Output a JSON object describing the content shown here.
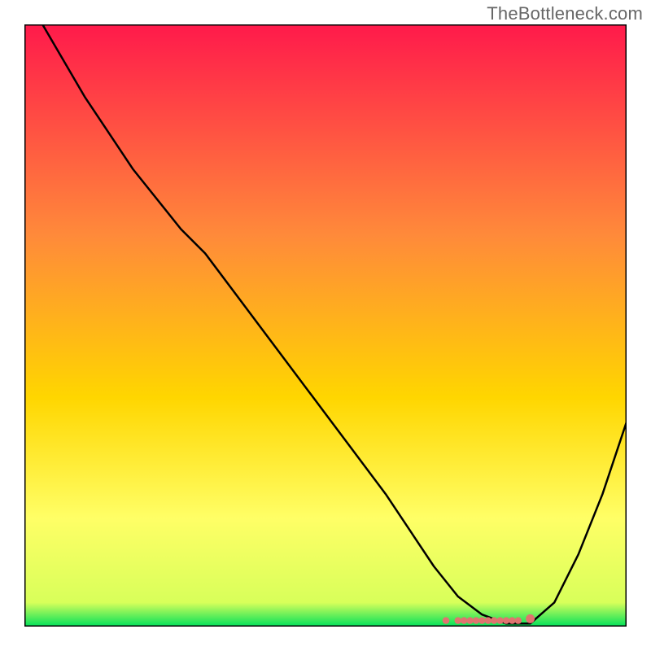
{
  "watermark": "TheBottleneck.com",
  "colors": {
    "gradient_top": "#ff1a4b",
    "gradient_mid1": "#ff8a3a",
    "gradient_mid2": "#ffd600",
    "gradient_mid3": "#ffff66",
    "gradient_bottom": "#00e05a",
    "curve": "#000000",
    "markers": "#e0736f",
    "frame": "#000000"
  },
  "chart_data": {
    "type": "line",
    "title": "",
    "xlabel": "",
    "ylabel": "",
    "xlim": [
      0,
      100
    ],
    "ylim": [
      0,
      100
    ],
    "series": [
      {
        "name": "curve",
        "x": [
          3,
          10,
          18,
          26,
          30,
          36,
          42,
          48,
          54,
          60,
          64,
          68,
          72,
          76,
          80,
          84,
          88,
          92,
          96,
          100
        ],
        "y": [
          100,
          88,
          76,
          66,
          62,
          54,
          46,
          38,
          30,
          22,
          16,
          10,
          5,
          2,
          0.5,
          0.5,
          4,
          12,
          22,
          34
        ]
      }
    ],
    "markers": {
      "name": "bottleneck-band",
      "x": [
        70,
        72,
        73,
        74,
        75,
        76,
        77,
        78,
        79,
        80,
        81,
        82,
        84
      ],
      "y": [
        1,
        1,
        1,
        1,
        1,
        1,
        1,
        1,
        1,
        1,
        1,
        1,
        1.3
      ]
    },
    "gradient_stops": [
      {
        "offset": 0.0,
        "color": "#ff1a4b"
      },
      {
        "offset": 0.35,
        "color": "#ff8a3a"
      },
      {
        "offset": 0.62,
        "color": "#ffd600"
      },
      {
        "offset": 0.82,
        "color": "#ffff66"
      },
      {
        "offset": 0.96,
        "color": "#d8ff5a"
      },
      {
        "offset": 1.0,
        "color": "#00e05a"
      }
    ],
    "grid": false
  }
}
